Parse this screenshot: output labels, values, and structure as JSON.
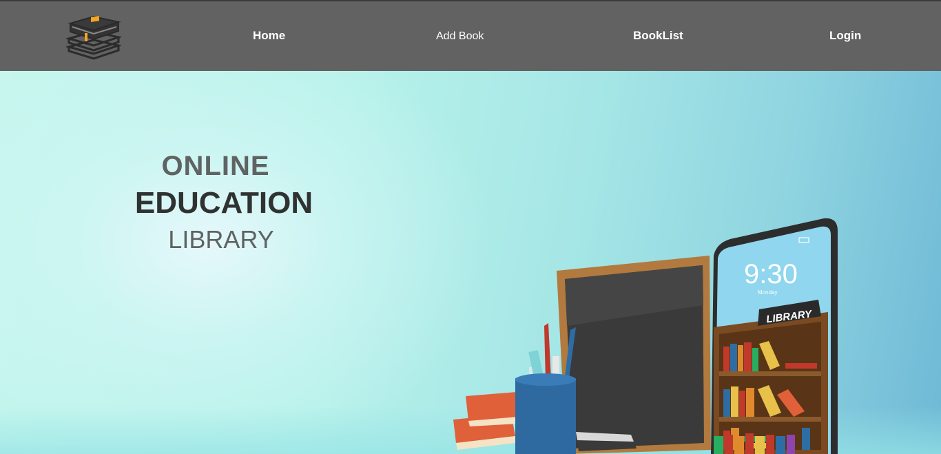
{
  "nav": {
    "home": "Home",
    "add_book": "Add Book",
    "booklist": "BookList",
    "login": "Login"
  },
  "hero": {
    "line1": "ONLINE",
    "line2": "EDUCATION",
    "line3": "LIBRARY"
  },
  "illustration": {
    "phone_time": "9:30",
    "phone_day": "Monday",
    "shelf_sign": "LIBRARY"
  },
  "colors": {
    "navbar": "#626262",
    "accent_bookmark": "#f5a623"
  }
}
